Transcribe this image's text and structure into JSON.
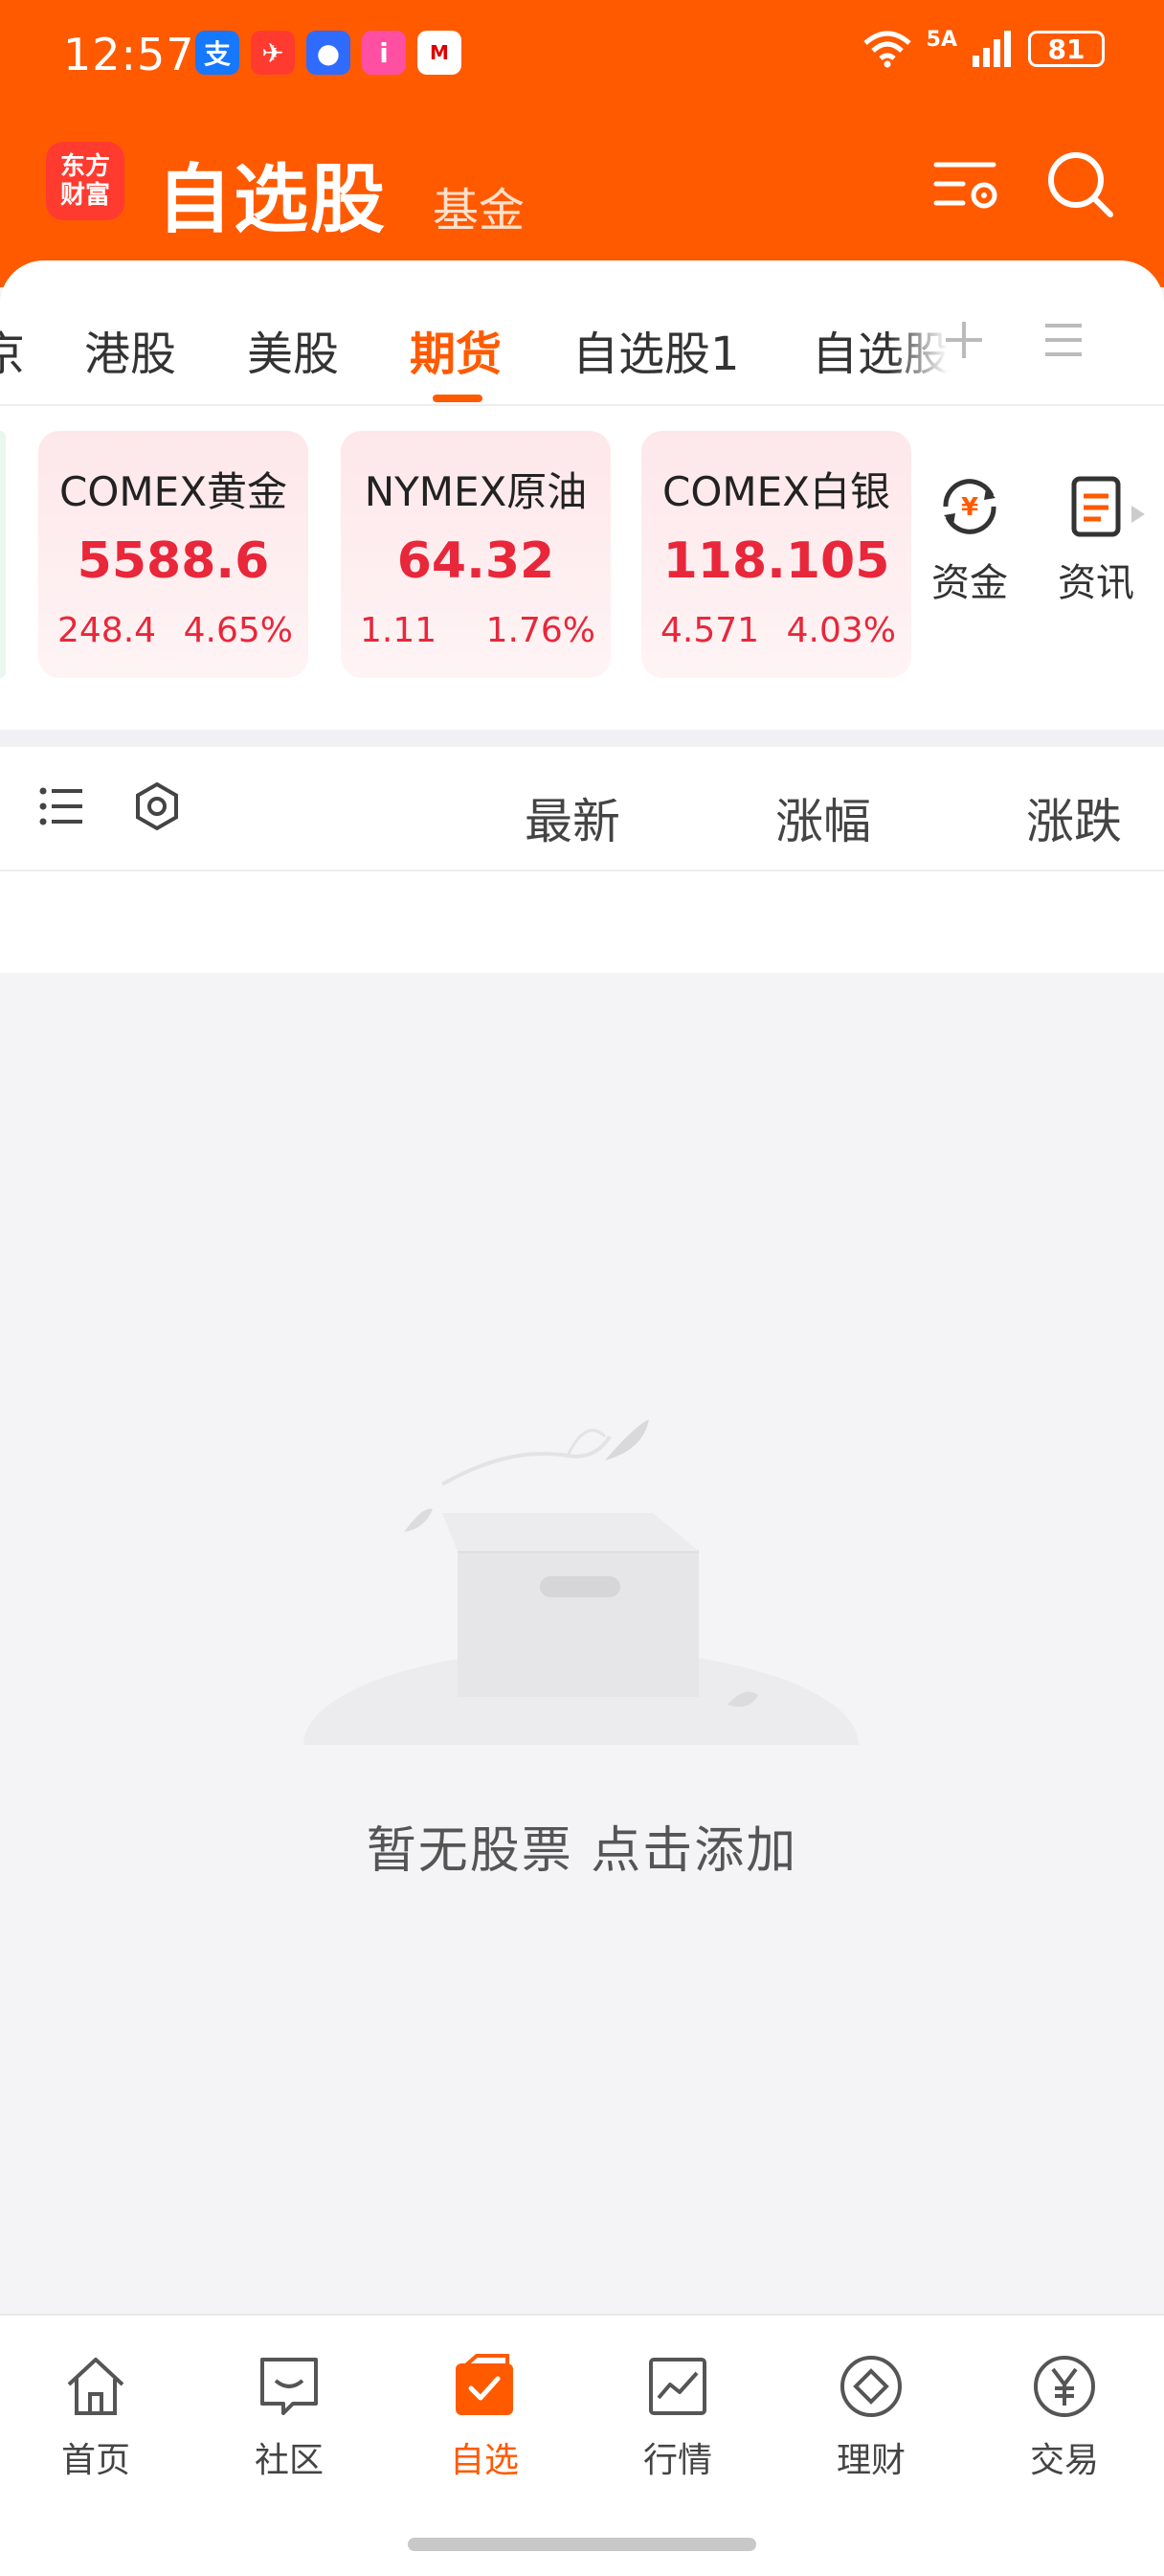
{
  "status_bar": {
    "time": "12:57",
    "network": "5A",
    "battery": "81",
    "notification_icons": [
      "alipay-icon",
      "message-app-icon",
      "chat-bubble-icon",
      "app-icon",
      "news-app-icon"
    ]
  },
  "header": {
    "logo_line1": "东方",
    "logo_line2": "财富",
    "title": "自选股",
    "fund_tab": "基金"
  },
  "tabs": {
    "items": [
      {
        "label": "京"
      },
      {
        "label": "港股"
      },
      {
        "label": "美股"
      },
      {
        "label": "期货",
        "active": true
      },
      {
        "label": "自选股1"
      },
      {
        "label": "自选股"
      }
    ]
  },
  "quotes": [
    {
      "name": "COMEX黄金",
      "price": "5588.6",
      "change": "248.4",
      "percent": "4.65%"
    },
    {
      "name": "NYMEX原油",
      "price": "64.32",
      "change": "1.11",
      "percent": "1.76%"
    },
    {
      "name": "COMEX白银",
      "price": "118.105",
      "change": "4.571",
      "percent": "4.03%"
    }
  ],
  "side_buttons": {
    "funds": "资金",
    "news": "资讯"
  },
  "columns": {
    "latest": "最新",
    "change_pct": "涨幅",
    "change": "涨跌"
  },
  "empty_state": {
    "text": "暂无股票 点击添加"
  },
  "bottom_nav": [
    {
      "label": "首页",
      "icon": "home-icon"
    },
    {
      "label": "社区",
      "icon": "community-icon"
    },
    {
      "label": "自选",
      "icon": "watchlist-icon",
      "active": true
    },
    {
      "label": "行情",
      "icon": "market-chart-icon"
    },
    {
      "label": "理财",
      "icon": "wealth-icon"
    },
    {
      "label": "交易",
      "icon": "trade-yen-icon"
    }
  ],
  "colors": {
    "brand": "#ff5a00",
    "up_red": "#e8273a"
  }
}
